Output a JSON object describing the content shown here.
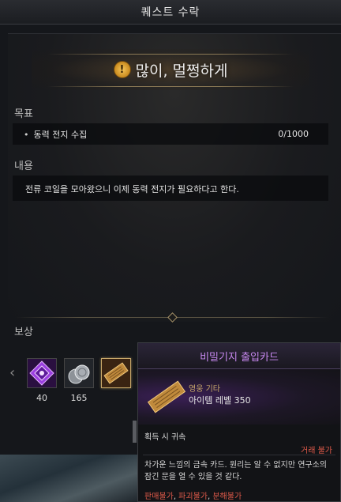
{
  "window": {
    "title": "퀘스트 수락"
  },
  "quest": {
    "title": "많이, 멀쩡하게",
    "icon": "quest-exclamation-icon"
  },
  "objective": {
    "label": "목표",
    "bullet": "•",
    "text": "동력 전지 수집",
    "progress": "0/1000"
  },
  "content": {
    "label": "내용",
    "text": "전류 코일을 모아왔으니 이제 동력 전지가 필요하다고 한다."
  },
  "rewards": {
    "label": "보상",
    "prev_arrow": "‹",
    "items": [
      {
        "icon": "purple-crystal-icon",
        "count": "40"
      },
      {
        "icon": "silver-coin-stack-icon",
        "count": "165"
      },
      {
        "icon": "access-card-icon",
        "count": ""
      }
    ]
  },
  "tooltip": {
    "name": "비밀기지 출입카드",
    "grade_type": "영웅 기타",
    "item_level": "아이템 레벨 350",
    "bound": "획득 시 귀속",
    "trade": "거래 불가",
    "description": "차가운 느낌의 금속 카드. 원리는 알 수 없지만 연구소의 잠긴 문을 열 수 있을 것 같다.",
    "flags": [
      "판매불가",
      "파괴불가",
      "분해불가"
    ],
    "flag_separator": ", "
  },
  "colors": {
    "hero_grade": "#c789f0",
    "warning": "#e05a4a",
    "gold": "#c8a86a"
  }
}
